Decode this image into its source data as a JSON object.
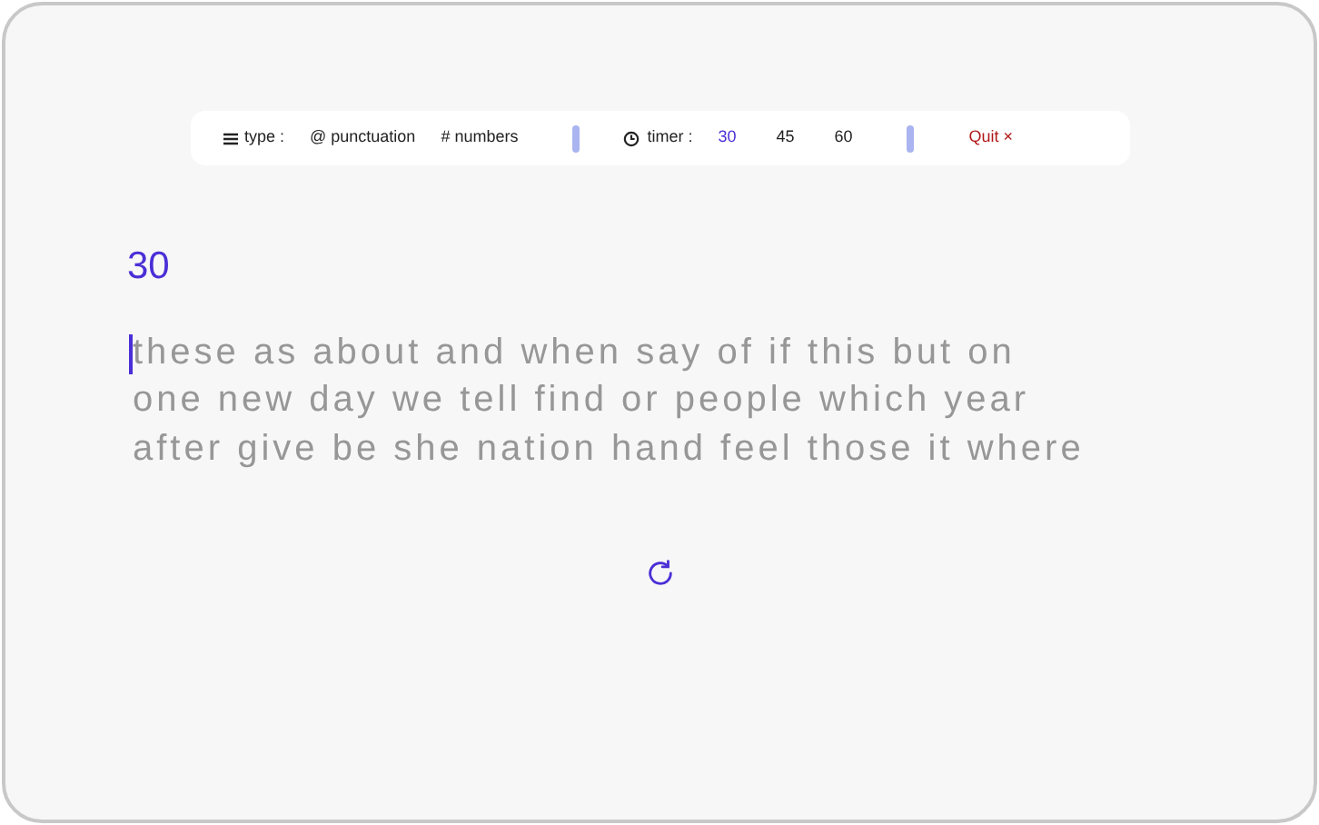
{
  "toolbar": {
    "type_label": "type :",
    "type_options": [
      {
        "label": "@ punctuation",
        "selected": false
      },
      {
        "label": "# numbers",
        "selected": false
      }
    ],
    "timer_label": "timer :",
    "timer_options": [
      {
        "label": "30",
        "selected": true
      },
      {
        "label": "45",
        "selected": false
      },
      {
        "label": "60",
        "selected": false
      }
    ],
    "quit": "Quit ×"
  },
  "countdown": "30",
  "lines": [
    "these as about and when say of if this but on",
    "one new day we tell find or people which year",
    "after give be she nation hand feel those it where"
  ]
}
